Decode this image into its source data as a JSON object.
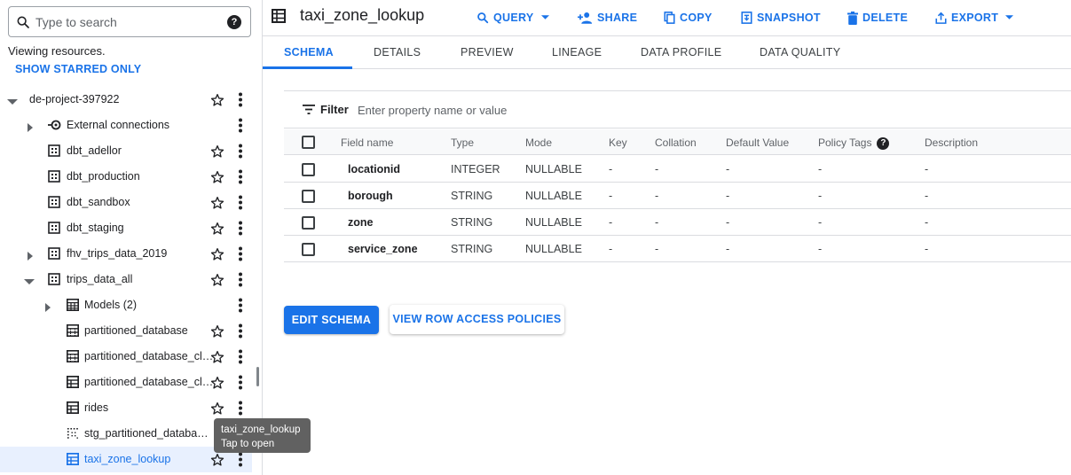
{
  "search": {
    "placeholder": "Type to search",
    "help_glyph": "?"
  },
  "explorer": {
    "viewing_text": "Viewing resources.",
    "show_starred": "SHOW STARRED ONLY",
    "items": [
      {
        "label": "de-project-397922",
        "icon": "none",
        "arrow": "expanded"
      },
      {
        "label": "External connections",
        "icon": "connection-icon",
        "arrow": "collapsed"
      },
      {
        "label": "dbt_adellor",
        "icon": "dataset-icon",
        "arrow": "none"
      },
      {
        "label": "dbt_production",
        "icon": "dataset-icon",
        "arrow": "none"
      },
      {
        "label": "dbt_sandbox",
        "icon": "dataset-icon",
        "arrow": "none"
      },
      {
        "label": "dbt_staging",
        "icon": "dataset-icon",
        "arrow": "none"
      },
      {
        "label": "fhv_trips_data_2019",
        "icon": "dataset-icon",
        "arrow": "collapsed"
      },
      {
        "label": "trips_data_all",
        "icon": "dataset-icon",
        "arrow": "expanded"
      },
      {
        "label": "Models (2)",
        "icon": "models-icon",
        "arrow": "collapsed"
      },
      {
        "label": "partitioned_database",
        "icon": "partitioned-table-icon",
        "arrow": "none"
      },
      {
        "label": "partitioned_database_cl…",
        "icon": "partitioned-table-icon",
        "arrow": "none"
      },
      {
        "label": "partitioned_database_cl…",
        "icon": "table-icon",
        "arrow": "none"
      },
      {
        "label": "rides",
        "icon": "table-icon",
        "arrow": "none"
      },
      {
        "label": "stg_partitioned_databa…",
        "icon": "external-table-icon",
        "arrow": "none"
      },
      {
        "label": "taxi_zone_lookup",
        "icon": "table-icon",
        "arrow": "none",
        "selected": true
      }
    ],
    "tooltip": {
      "title": "taxi_zone_lookup",
      "subtitle": "Tap to open"
    }
  },
  "header": {
    "title": "taxi_zone_lookup",
    "actions": {
      "query": "QUERY",
      "share": "SHARE",
      "copy": "COPY",
      "snapshot": "SNAPSHOT",
      "delete": "DELETE",
      "export": "EXPORT"
    }
  },
  "tabs": [
    "SCHEMA",
    "DETAILS",
    "PREVIEW",
    "LINEAGE",
    "DATA PROFILE",
    "DATA QUALITY"
  ],
  "active_tab": "SCHEMA",
  "filter": {
    "label": "Filter",
    "placeholder": "Enter property name or value"
  },
  "table": {
    "headers": [
      "Field name",
      "Type",
      "Mode",
      "Key",
      "Collation",
      "Default Value",
      "Policy Tags",
      "Description"
    ],
    "rows": [
      [
        "locationid",
        "INTEGER",
        "NULLABLE",
        "-",
        "-",
        "-",
        "-",
        "-"
      ],
      [
        "borough",
        "STRING",
        "NULLABLE",
        "-",
        "-",
        "-",
        "-",
        "-"
      ],
      [
        "zone",
        "STRING",
        "NULLABLE",
        "-",
        "-",
        "-",
        "-",
        "-"
      ],
      [
        "service_zone",
        "STRING",
        "NULLABLE",
        "-",
        "-",
        "-",
        "-",
        "-"
      ]
    ]
  },
  "buttons": {
    "edit_schema": "EDIT SCHEMA",
    "row_access": "VIEW ROW ACCESS POLICIES"
  },
  "colors": {
    "accent": "#1a73e8",
    "selected_bg": "#e8f0fe",
    "tooltip_bg": "#616161"
  }
}
